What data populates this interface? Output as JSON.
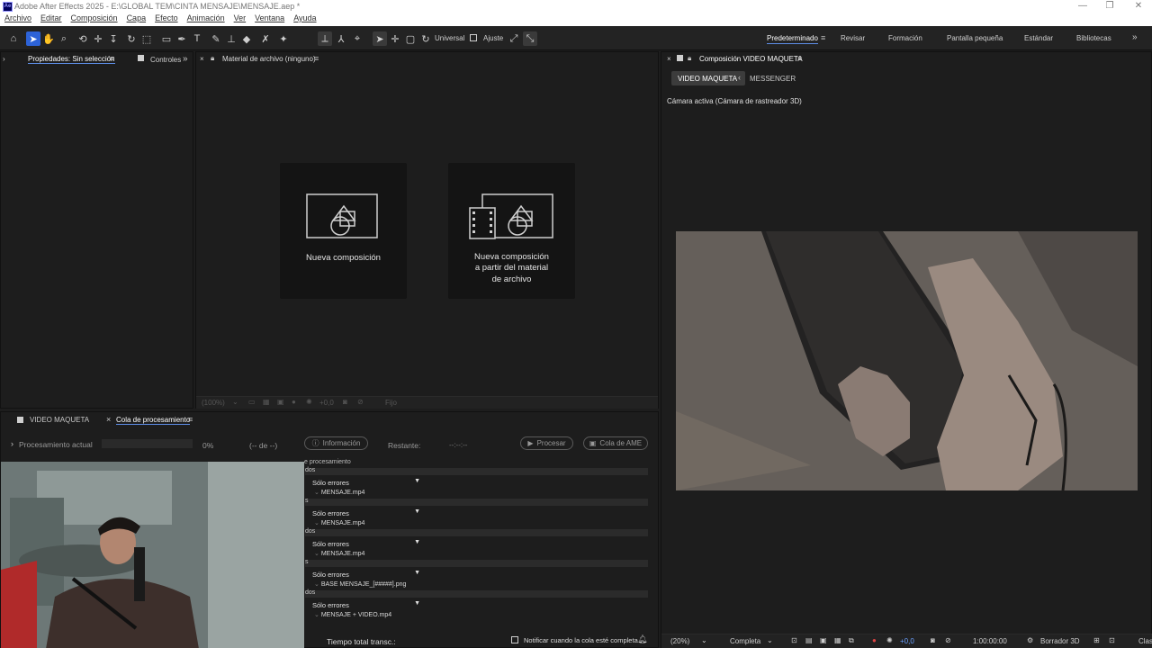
{
  "window": {
    "title": "Adobe After Effects 2025 - E:\\GLOBAL TEM\\CINTA MENSAJE\\MENSAJE.aep *",
    "logo_text": "Ae",
    "minimize": "—",
    "restore": "❐",
    "close": "✕"
  },
  "menu": [
    "Archivo",
    "Editar",
    "Composición",
    "Capa",
    "Efecto",
    "Animación",
    "Ver",
    "Ventana",
    "Ayuda"
  ],
  "toolbar": {
    "universal_label": "Universal",
    "ajuste_label": "Ajuste",
    "workspaces": [
      "Predeterminado",
      "Revisar",
      "Formación",
      "Pantalla pequeña",
      "Estándar",
      "Bibliotecas"
    ],
    "more": "»"
  },
  "properties_panel": {
    "tab_properties": "Propiedades: Sin selección",
    "tab_controls": "Controles",
    "more": "»"
  },
  "project_panel": {
    "title": "Material de archivo (ninguno)",
    "new_comp": "Nueva composición",
    "new_comp_from_footage_lines": [
      "Nueva composición",
      "a partir del material",
      "de archivo"
    ],
    "zoom": "(100%)",
    "exposure": "+0,0",
    "fixed": "Fijo"
  },
  "render_queue": {
    "tab_comp": "VIDEO MAQUETA",
    "tab_queue": "Cola de procesamiento",
    "current_label": "Procesamiento actual",
    "percent": "0%",
    "of_label": "(-- de --)",
    "info_button": "Información",
    "remaining_label": "Restante:",
    "remaining_value": "--:--:--",
    "render_button": "Procesar",
    "ame_button": "Cola de AME",
    "column_header": "e procesamiento",
    "row_prefixes": [
      "dos",
      "s",
      "dos",
      "s",
      "dos"
    ],
    "log_label": "Sólo errores",
    "files": [
      "MENSAJE.mp4",
      "MENSAJE.mp4",
      "MENSAJE.mp4",
      "BASE MENSAJE_[#####].png",
      "MENSAJE + VIDEO.mp4"
    ],
    "total_time": "Tiempo total transc.:",
    "notify": "Notificar cuando la cola esté completa"
  },
  "composition_panel": {
    "title": "Composición VIDEO MAQUETA",
    "tab_active": "VIDEO MAQUETA",
    "tab_other": "MESSENGER",
    "camera_label": "Cámara activa (Cámara de rastreador 3D)",
    "zoom": "(20%)",
    "resolution": "Completa",
    "exposure": "+0,0",
    "timecode": "1:00:00:00",
    "renderer": "Borrador 3D",
    "trailing": "Clas"
  },
  "colors": {
    "accent": "#2d63d8",
    "panel_bg": "#1d1d1d",
    "title_bar": "#ffffff"
  }
}
